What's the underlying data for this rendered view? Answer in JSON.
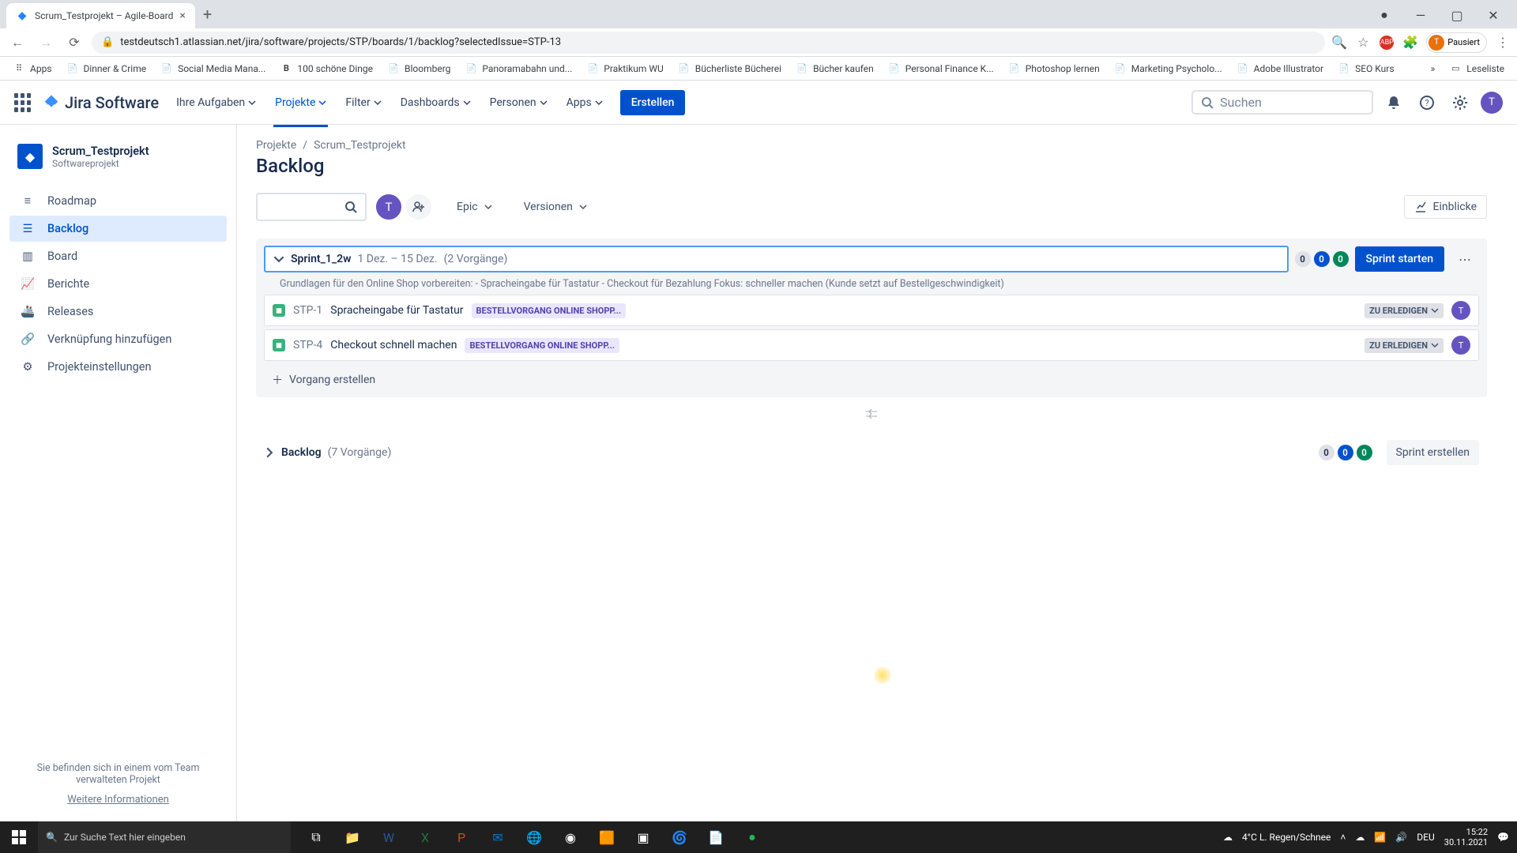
{
  "browser": {
    "tab_title": "Scrum_Testprojekt – Agile-Board",
    "url": "testdeutsch1.atlassian.net/jira/software/projects/STP/boards/1/backlog?selectedIssue=STP-13",
    "avatar_state": "Pausiert"
  },
  "bookmarks": [
    "Apps",
    "Dinner & Crime",
    "Social Media Mana...",
    "100 schöne Dinge",
    "Bloomberg",
    "Panoramabahn und...",
    "Praktikum WU",
    "Bücherliste Bücherei",
    "Bücher kaufen",
    "Personal Finance K...",
    "Photoshop lernen",
    "Marketing Psycholo...",
    "Adobe Illustrator",
    "SEO Kurs"
  ],
  "reading_list": "Leseliste",
  "topnav": {
    "items": [
      "Ihre Aufgaben",
      "Projekte",
      "Filter",
      "Dashboards",
      "Personen",
      "Apps"
    ],
    "active_index": 1,
    "create": "Erstellen",
    "search_placeholder": "Suchen",
    "logo": "Jira Software"
  },
  "sidebar": {
    "project_name": "Scrum_Testprojekt",
    "project_type": "Softwareprojekt",
    "items": [
      "Roadmap",
      "Backlog",
      "Board",
      "Berichte",
      "Releases",
      "Verknüpfung hinzufügen",
      "Projekteinstellungen"
    ],
    "active_index": 1,
    "footer_text": "Sie befinden sich in einem vom Team verwalteten Projekt",
    "footer_link": "Weitere Informationen"
  },
  "breadcrumbs": [
    "Projekte",
    "Scrum_Testprojekt"
  ],
  "page_title": "Backlog",
  "filters": {
    "epic": "Epic",
    "versions": "Versionen",
    "insights": "Einblicke",
    "avatar_initial": "T"
  },
  "sprint": {
    "name": "Sprint_1_2w",
    "dates": "1 Dez. – 15 Dez.",
    "count_label": "(2 Vorgänge)",
    "badges": [
      "0",
      "0",
      "0"
    ],
    "start_btn": "Sprint starten",
    "goal": "Grundlagen für den Online Shop vorbereiten: - Spracheingabe für Tastatur - Checkout für Bezahlung Fokus: schneller machen (Kunde setzt auf Bestellgeschwindigkeit)",
    "issues": [
      {
        "key": "STP-1",
        "title": "Spracheingabe für Tastatur",
        "epic": "BESTELLVORGANG ONLINE SHOPP...",
        "status": "ZU ERLEDIGEN",
        "avatar": "T"
      },
      {
        "key": "STP-4",
        "title": "Checkout schnell machen",
        "epic": "BESTELLVORGANG ONLINE SHOPP...",
        "status": "ZU ERLEDIGEN",
        "avatar": "T"
      }
    ],
    "create_issue": "Vorgang erstellen"
  },
  "backlog_section": {
    "title": "Backlog",
    "count_label": "(7 Vorgänge)",
    "badges": [
      "0",
      "0",
      "0"
    ],
    "create_sprint": "Sprint erstellen"
  },
  "taskbar": {
    "search_placeholder": "Zur Suche Text hier eingeben",
    "weather": "4°C  L. Regen/Schnee",
    "lang": "DEU",
    "time": "15:22",
    "date": "30.11.2021"
  }
}
